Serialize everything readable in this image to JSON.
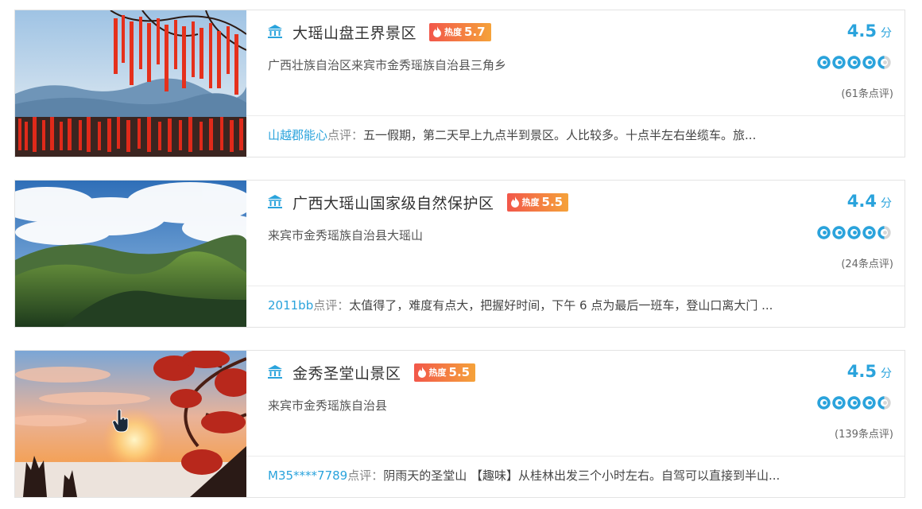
{
  "listings": [
    {
      "name": "大瑶山盘王界景区",
      "heat_label": "热度",
      "heat_value": "5.7",
      "address": "广西壮族自治区来宾市金秀瑶族自治县三角乡",
      "score": "4.5",
      "score_unit": "分",
      "rating": 4.5,
      "reviews": "(61条点评)",
      "comment_user": "山越郡能心",
      "comment_label": "点评：",
      "comment_text": "五一假期，第二天早上九点半到景区。人比较多。十点半左右坐缆车。旅..."
    },
    {
      "name": "广西大瑶山国家级自然保护区",
      "heat_label": "热度",
      "heat_value": "5.5",
      "address": "来宾市金秀瑶族自治县大瑶山",
      "score": "4.4",
      "score_unit": "分",
      "rating": 4.5,
      "reviews": "(24条点评)",
      "comment_user": "2011bb",
      "comment_label": "点评：",
      "comment_text": "太值得了，难度有点大，把握好时间，下午 6 点为最后一班车，登山口离大门 ..."
    },
    {
      "name": "金秀圣堂山景区",
      "heat_label": "热度",
      "heat_value": "5.5",
      "address": "来宾市金秀瑶族自治县",
      "score": "4.5",
      "score_unit": "分",
      "rating": 4.5,
      "reviews": "(139条点评)",
      "comment_user": "M35****7789",
      "comment_label": "点评：",
      "comment_text": "阴雨天的圣堂山 【趣味】从桂林出发三个小时左右。自驾可以直接到半山..."
    }
  ],
  "colors": {
    "accent": "#2aa3dc",
    "heat_start": "#f2574a",
    "heat_end": "#f5a23a",
    "border": "#e3e3e3"
  },
  "icons": {
    "poi": "landmark-icon",
    "heat": "flame-icon",
    "rating": "rating-dot-icon",
    "cursor": "hand-pointer-icon"
  }
}
